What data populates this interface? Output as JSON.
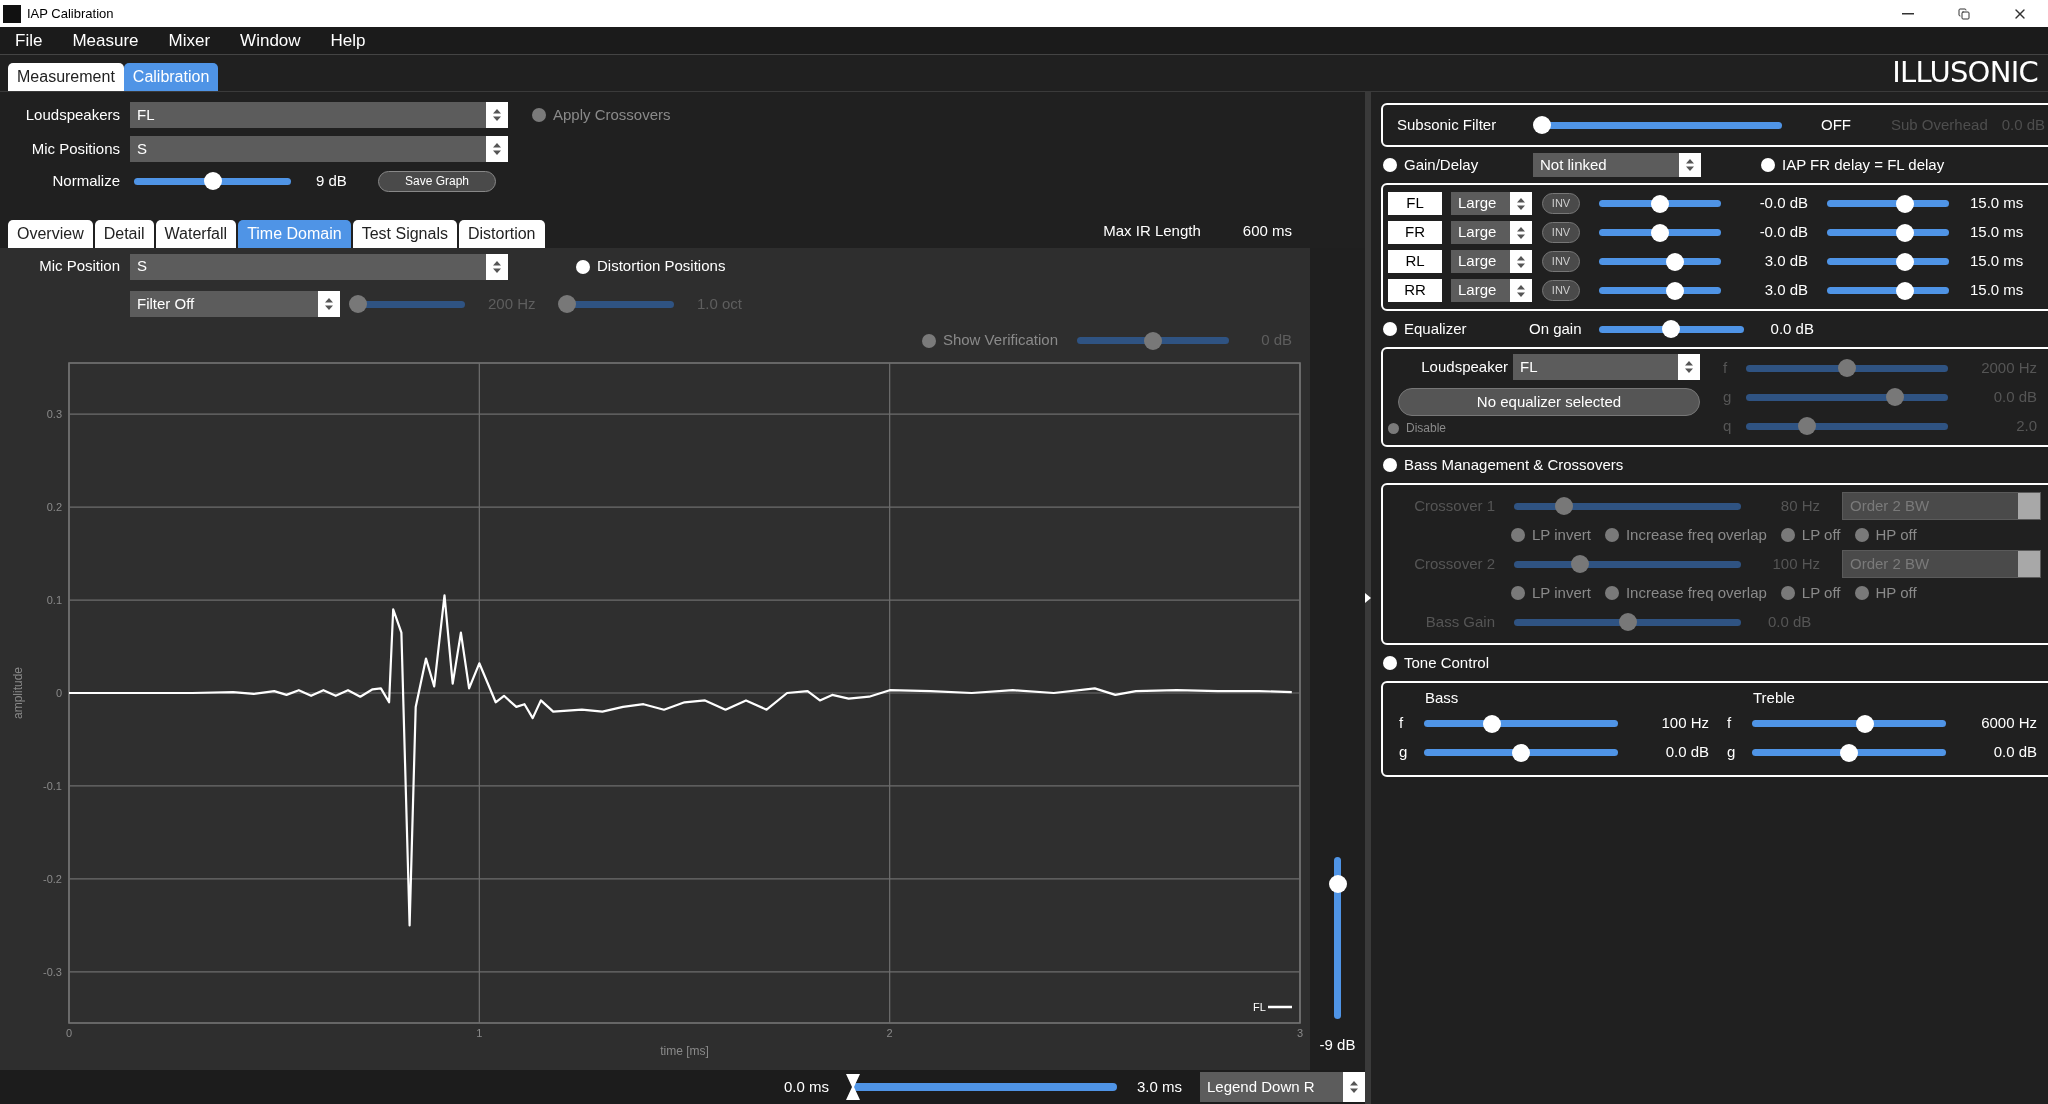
{
  "window": {
    "title": "IAP Calibration"
  },
  "menu": [
    "File",
    "Measure",
    "Mixer",
    "Window",
    "Help"
  ],
  "brand": "ILLUSONIC",
  "main_tabs": [
    {
      "label": "Measurement",
      "selected": false
    },
    {
      "label": "Calibration",
      "selected": true
    }
  ],
  "setup": {
    "loudspeakers": {
      "label": "Loudspeakers",
      "value": "FL"
    },
    "mic_positions": {
      "label": "Mic Positions",
      "value": "S"
    },
    "apply_crossovers": {
      "label": "Apply Crossovers",
      "disabled": true
    },
    "normalize": {
      "label": "Normalize",
      "level": 0.5,
      "reading": "9 dB"
    },
    "save_button": "Save Graph"
  },
  "view_tabs": [
    {
      "label": "Overview",
      "selected": false
    },
    {
      "label": "Detail",
      "selected": false
    },
    {
      "label": "Waterfall",
      "selected": false
    },
    {
      "label": "Time Domain",
      "selected": true
    },
    {
      "label": "Test Signals",
      "selected": false
    },
    {
      "label": "Distortion",
      "selected": false
    }
  ],
  "max_ir": {
    "label": "Max IR Length",
    "value": "600 ms"
  },
  "mic_position": {
    "label": "Mic Position",
    "value": "S"
  },
  "distortion_positions": {
    "label": "Distortion Positions",
    "disabled": false
  },
  "filter": {
    "value": "Filter Off",
    "disabled": true,
    "frequency": {
      "level": 0,
      "reading": "200 Hz"
    },
    "octave": {
      "level": 0,
      "reading": "1.0 oct"
    }
  },
  "verification": {
    "label": "Show Verification",
    "disabled": true,
    "level": 0.5,
    "reading": "0 dB"
  },
  "chart": {
    "chart_data": {
      "type": "line",
      "grid": true,
      "xlabel": "time [ms]",
      "ylabel": "amplitude",
      "xlim": [
        0,
        3
      ],
      "ylim": [
        -0.355,
        0.355
      ],
      "xticks": [
        0,
        1,
        2,
        3
      ],
      "yticks": [
        -0.3,
        -0.2,
        -0.1,
        0,
        0.1,
        0.2,
        0.3
      ],
      "x": [
        0,
        0.1,
        0.2,
        0.3,
        0.4,
        0.45,
        0.5,
        0.53,
        0.56,
        0.59,
        0.62,
        0.65,
        0.68,
        0.71,
        0.74,
        0.76,
        0.78,
        0.79,
        0.81,
        0.83,
        0.845,
        0.87,
        0.89,
        0.915,
        0.935,
        0.955,
        0.975,
        1.0,
        1.04,
        1.06,
        1.09,
        1.11,
        1.13,
        1.15,
        1.18,
        1.25,
        1.3,
        1.35,
        1.4,
        1.45,
        1.5,
        1.55,
        1.6,
        1.65,
        1.7,
        1.75,
        1.8,
        1.83,
        1.86,
        1.9,
        1.95,
        2.0,
        2.1,
        2.2,
        2.3,
        2.4,
        2.5,
        2.55,
        2.6,
        2.7,
        2.8,
        2.9,
        2.98
      ],
      "series": [
        {
          "name": "FL",
          "color": "#ffffff",
          "values": [
            0,
            0,
            0,
            0,
            0.001,
            -0.001,
            0.002,
            -0.002,
            0.003,
            -0.003,
            0.003,
            -0.003,
            0.003,
            -0.004,
            0.004,
            0.005,
            -0.01,
            0.09,
            0.065,
            -0.25,
            -0.015,
            0.037,
            0.007,
            0.105,
            0.01,
            0.065,
            0.005,
            0.032,
            -0.01,
            -0.003,
            -0.015,
            -0.012,
            -0.027,
            -0.008,
            -0.02,
            -0.018,
            -0.02,
            -0.015,
            -0.012,
            -0.018,
            -0.01,
            -0.008,
            -0.018,
            -0.008,
            -0.018,
            0,
            0.002,
            -0.008,
            -0.002,
            -0.006,
            -0.004,
            0.003,
            0.002,
            0,
            0.003,
            0,
            0.005,
            -0.002,
            0.002,
            0.003,
            0.002,
            0.002,
            0.001
          ]
        }
      ]
    }
  },
  "vertical_slider": {
    "level": 0.83,
    "reading": "-9 dB"
  },
  "bottom": {
    "start": "0.0 ms",
    "range": {
      "level": 0
    },
    "end": "3.0 ms",
    "legend_mode": "Legend Down R"
  },
  "subsonic": {
    "label": "Subsonic Filter",
    "level": 0,
    "reading": "OFF",
    "overhead_label": "Sub Overhead",
    "overhead_reading": "0.0 dB",
    "overhead_disabled": true
  },
  "gain_delay": {
    "label": "Gain/Delay",
    "disabled": false,
    "link": "Not linked",
    "iap_delay": {
      "label": "IAP FR delay = FL delay",
      "disabled": false
    },
    "channels": [
      {
        "name": "FL",
        "size": "Large",
        "invert": "INV",
        "inverted": false,
        "gain": {
          "level": 0.5,
          "reading": "-0.0 dB"
        },
        "delay": {
          "level": 0.64,
          "reading": "15.0 ms"
        }
      },
      {
        "name": "FR",
        "size": "Large",
        "invert": "INV",
        "inverted": false,
        "gain": {
          "level": 0.5,
          "reading": "-0.0 dB"
        },
        "delay": {
          "level": 0.64,
          "reading": "15.0 ms"
        }
      },
      {
        "name": "RL",
        "size": "Large",
        "invert": "INV",
        "inverted": false,
        "gain": {
          "level": 0.62,
          "reading": "3.0 dB"
        },
        "delay": {
          "level": 0.64,
          "reading": "15.0 ms"
        }
      },
      {
        "name": "RR",
        "size": "Large",
        "invert": "INV",
        "inverted": false,
        "gain": {
          "level": 0.62,
          "reading": "3.0 dB"
        },
        "delay": {
          "level": 0.64,
          "reading": "15.0 ms"
        }
      }
    ]
  },
  "equalizer": {
    "label": "Equalizer",
    "disabled": false,
    "on_gain_label": "On gain",
    "on_gain": {
      "level": 0.5,
      "reading": "0.0 dB"
    },
    "loudspeaker_label": "Loudspeaker",
    "loudspeaker": "FL",
    "status": "No equalizer selected",
    "disable": {
      "label": "Disable",
      "disabled": true
    },
    "params_disabled": true,
    "params": [
      {
        "name": "f",
        "level": 0.5,
        "reading": "2000 Hz"
      },
      {
        "name": "g",
        "level": 0.74,
        "reading": "0.0 dB"
      },
      {
        "name": "q",
        "level": 0.3,
        "reading": "2.0"
      }
    ]
  },
  "bass_management": {
    "label": "Bass Management & Crossovers",
    "header_disabled": false,
    "disabled": true,
    "crossovers": [
      {
        "label": "Crossover 1",
        "level": 0.22,
        "reading": "80 Hz",
        "order": "Order 2 BW",
        "options": [
          {
            "label": "LP invert",
            "disabled": true
          },
          {
            "label": "Increase freq overlap",
            "disabled": true
          },
          {
            "label": "LP off",
            "disabled": true
          },
          {
            "label": "HP off",
            "disabled": true
          }
        ]
      },
      {
        "label": "Crossover 2",
        "level": 0.29,
        "reading": "100 Hz",
        "order": "Order 2 BW",
        "options": [
          {
            "label": "LP invert",
            "disabled": true
          },
          {
            "label": "Increase freq overlap",
            "disabled": true
          },
          {
            "label": "LP off",
            "disabled": true
          },
          {
            "label": "HP off",
            "disabled": true
          }
        ]
      }
    ],
    "bass_gain": {
      "label": "Bass Gain",
      "level": 0.5,
      "reading": "0.0 dB"
    }
  },
  "tone_control": {
    "label": "Tone Control",
    "disabled": false,
    "groups": [
      {
        "title": "Bass",
        "params": [
          {
            "name": "f",
            "level": 0.35,
            "reading": "100 Hz"
          },
          {
            "name": "g",
            "level": 0.5,
            "reading": "0.0 dB"
          }
        ]
      },
      {
        "title": "Treble",
        "params": [
          {
            "name": "f",
            "level": 0.58,
            "reading": "6000 Hz"
          },
          {
            "name": "g",
            "level": 0.5,
            "reading": "0.0 dB"
          }
        ]
      }
    ]
  }
}
